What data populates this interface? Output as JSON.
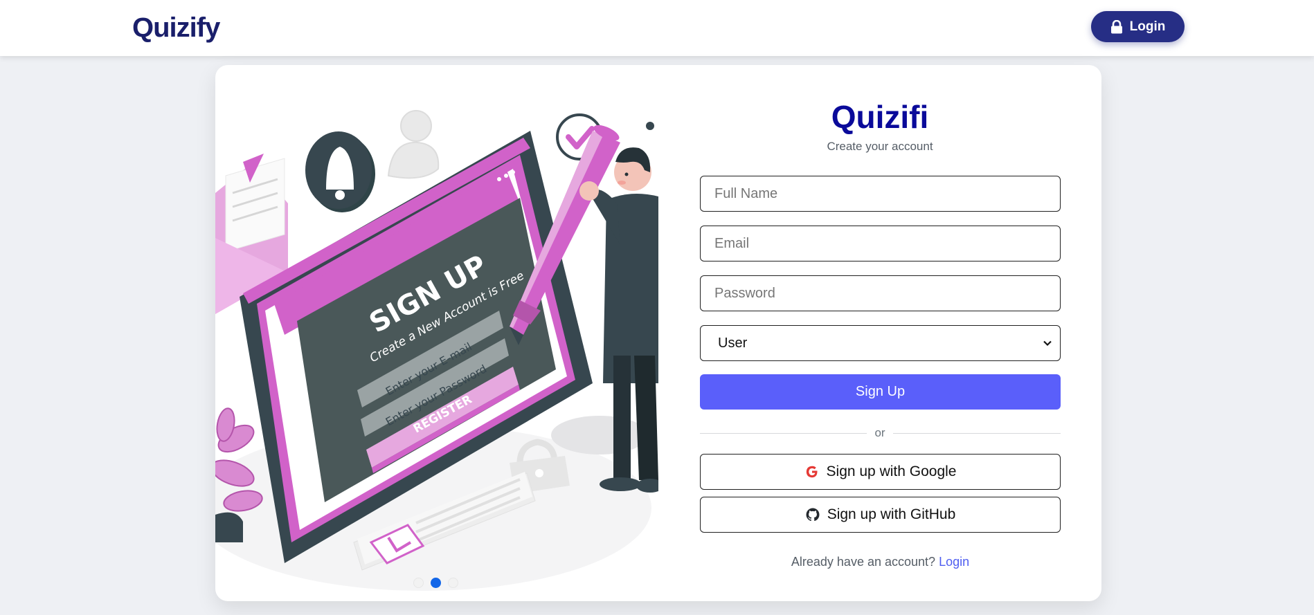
{
  "navbar": {
    "brand": "Quizify",
    "login_label": "Login"
  },
  "illustration": {
    "heading": "SIGN UP",
    "subheading": "Create a New Account is Free",
    "email_field": "Enter your E-mail",
    "password_field": "Enter your Password",
    "register_button": "REGISTER",
    "carousel_active_index": 1
  },
  "form": {
    "title": "Quizifi",
    "subtitle": "Create your account",
    "full_name_placeholder": "Full Name",
    "email_placeholder": "Email",
    "password_placeholder": "Password",
    "role_selected": "User",
    "signup_label": "Sign Up",
    "divider_text": "or",
    "google_label": "Sign up with Google",
    "github_label": "Sign up with GitHub",
    "already_text": "Already have an account?",
    "login_link": "Login"
  },
  "colors": {
    "brand_navy": "#1a1f6b",
    "title_blue": "#0a0a9a",
    "primary_button": "#5a5ffa",
    "nav_button": "#262e85",
    "illustration_pink": "#d162c9",
    "illustration_slate": "#37474f"
  }
}
